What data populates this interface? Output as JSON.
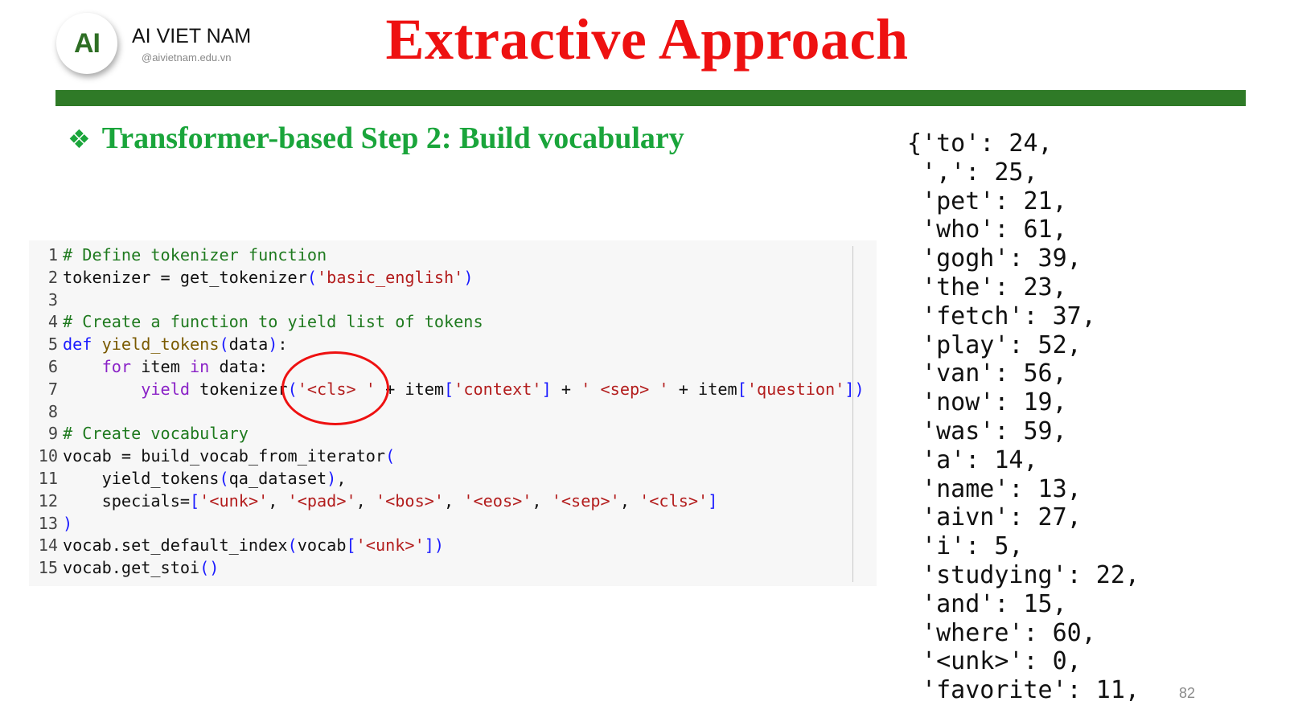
{
  "logo": {
    "mark": "AI",
    "name": "AI VIET NAM",
    "handle": "@aivietnam.edu.vn"
  },
  "title": "Extractive Approach",
  "subtitle": {
    "bullet": "❖",
    "text": "Transformer-based Step 2: Build vocabulary"
  },
  "code_lines": [
    {
      "n": "1",
      "parts": [
        {
          "t": "# Define tokenizer function",
          "c": "cm"
        }
      ]
    },
    {
      "n": "2",
      "parts": [
        {
          "t": "tokenizer = get_tokenizer",
          "c": ""
        },
        {
          "t": "(",
          "c": "pr"
        },
        {
          "t": "'basic_english'",
          "c": "st"
        },
        {
          "t": ")",
          "c": "pr"
        }
      ]
    },
    {
      "n": "3",
      "parts": []
    },
    {
      "n": "4",
      "parts": [
        {
          "t": "# Create a function to yield list of tokens",
          "c": "cm"
        }
      ]
    },
    {
      "n": "5",
      "parts": [
        {
          "t": "def",
          "c": "kw"
        },
        {
          "t": " ",
          "c": ""
        },
        {
          "t": "yield_tokens",
          "c": "fn"
        },
        {
          "t": "(",
          "c": "pr"
        },
        {
          "t": "data",
          "c": ""
        },
        {
          "t": ")",
          "c": "pr"
        },
        {
          "t": ":",
          "c": ""
        }
      ]
    },
    {
      "n": "6",
      "parts": [
        {
          "t": "    ",
          "c": ""
        },
        {
          "t": "for",
          "c": "kp"
        },
        {
          "t": " item ",
          "c": ""
        },
        {
          "t": "in",
          "c": "kp"
        },
        {
          "t": " data:",
          "c": ""
        }
      ]
    },
    {
      "n": "7",
      "parts": [
        {
          "t": "        ",
          "c": ""
        },
        {
          "t": "yield",
          "c": "kp"
        },
        {
          "t": " tokenizer",
          "c": ""
        },
        {
          "t": "(",
          "c": "pr"
        },
        {
          "t": "'<cls> '",
          "c": "st"
        },
        {
          "t": " + item",
          "c": ""
        },
        {
          "t": "[",
          "c": "pr"
        },
        {
          "t": "'context'",
          "c": "st"
        },
        {
          "t": "]",
          "c": "pr"
        },
        {
          "t": " + ",
          "c": ""
        },
        {
          "t": "' <sep> '",
          "c": "st"
        },
        {
          "t": " + item",
          "c": ""
        },
        {
          "t": "[",
          "c": "pr"
        },
        {
          "t": "'question'",
          "c": "st"
        },
        {
          "t": "])",
          "c": "pr"
        }
      ]
    },
    {
      "n": "8",
      "parts": []
    },
    {
      "n": "9",
      "parts": [
        {
          "t": "# Create vocabulary",
          "c": "cm"
        }
      ]
    },
    {
      "n": "10",
      "parts": [
        {
          "t": "vocab = build_vocab_from_iterator",
          "c": ""
        },
        {
          "t": "(",
          "c": "pr"
        }
      ]
    },
    {
      "n": "11",
      "parts": [
        {
          "t": "    yield_tokens",
          "c": ""
        },
        {
          "t": "(",
          "c": "pr"
        },
        {
          "t": "qa_dataset",
          "c": ""
        },
        {
          "t": ")",
          "c": "pr"
        },
        {
          "t": ",",
          "c": ""
        }
      ]
    },
    {
      "n": "12",
      "parts": [
        {
          "t": "    specials=",
          "c": ""
        },
        {
          "t": "[",
          "c": "pr"
        },
        {
          "t": "'<unk>'",
          "c": "st"
        },
        {
          "t": ", ",
          "c": ""
        },
        {
          "t": "'<pad>'",
          "c": "st"
        },
        {
          "t": ", ",
          "c": ""
        },
        {
          "t": "'<bos>'",
          "c": "st"
        },
        {
          "t": ", ",
          "c": ""
        },
        {
          "t": "'<eos>'",
          "c": "st"
        },
        {
          "t": ", ",
          "c": ""
        },
        {
          "t": "'<sep>'",
          "c": "st"
        },
        {
          "t": ", ",
          "c": ""
        },
        {
          "t": "'<cls>'",
          "c": "st"
        },
        {
          "t": "]",
          "c": "pr"
        }
      ]
    },
    {
      "n": "13",
      "parts": [
        {
          "t": ")",
          "c": "pr"
        }
      ]
    },
    {
      "n": "14",
      "parts": [
        {
          "t": "vocab.set_default_index",
          "c": ""
        },
        {
          "t": "(",
          "c": "pr"
        },
        {
          "t": "vocab",
          "c": ""
        },
        {
          "t": "[",
          "c": "pr"
        },
        {
          "t": "'<unk>'",
          "c": "st"
        },
        {
          "t": "])",
          "c": "pr"
        }
      ]
    },
    {
      "n": "15",
      "parts": [
        {
          "t": "vocab.get_stoi",
          "c": ""
        },
        {
          "t": "()",
          "c": "pr"
        }
      ]
    }
  ],
  "vocab_output": [
    "{'to': 24,",
    " ',': 25,",
    " 'pet': 21,",
    " 'who': 61,",
    " 'gogh': 39,",
    " 'the': 23,",
    " 'fetch': 37,",
    " 'play': 52,",
    " 'van': 56,",
    " 'now': 19,",
    " 'was': 59,",
    " 'a': 14,",
    " 'name': 13,",
    " 'aivn': 27,",
    " 'i': 5,",
    " 'studying': 22,",
    " 'and': 15,",
    " 'where': 60,",
    " '<unk>': 0,",
    " 'favorite': 11,"
  ],
  "page_number": "82",
  "colors": {
    "title": "#ee1111",
    "subtitle": "#1aa53b",
    "bar": "#2f7a27",
    "annotation_circle": "#ee1111"
  }
}
